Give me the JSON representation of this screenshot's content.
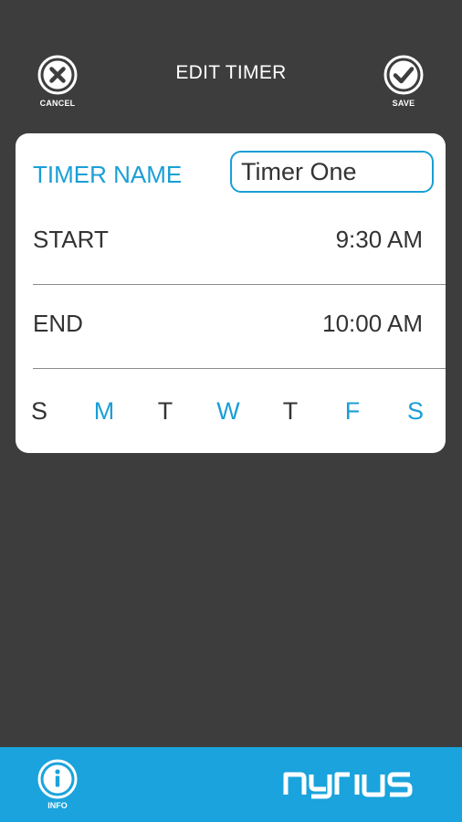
{
  "header": {
    "title": "EDIT TIMER",
    "cancel_label": "CANCEL",
    "save_label": "SAVE"
  },
  "form": {
    "name_label": "TIMER NAME",
    "name_value": "Timer One",
    "start_label": "START",
    "start_value": "9:30 AM",
    "end_label": "END",
    "end_value": "10:00 AM"
  },
  "days": [
    {
      "letter": "S",
      "active": false
    },
    {
      "letter": "M",
      "active": true
    },
    {
      "letter": "T",
      "active": false
    },
    {
      "letter": "W",
      "active": true
    },
    {
      "letter": "T",
      "active": false
    },
    {
      "letter": "F",
      "active": true
    },
    {
      "letter": "S",
      "active": true
    }
  ],
  "footer": {
    "info_label": "INFO",
    "logo": "nyrius"
  },
  "colors": {
    "accent": "#1a9fd6",
    "background": "#3d3d3d",
    "inactive_day": "#333333",
    "footer": "#1aa3dc"
  }
}
